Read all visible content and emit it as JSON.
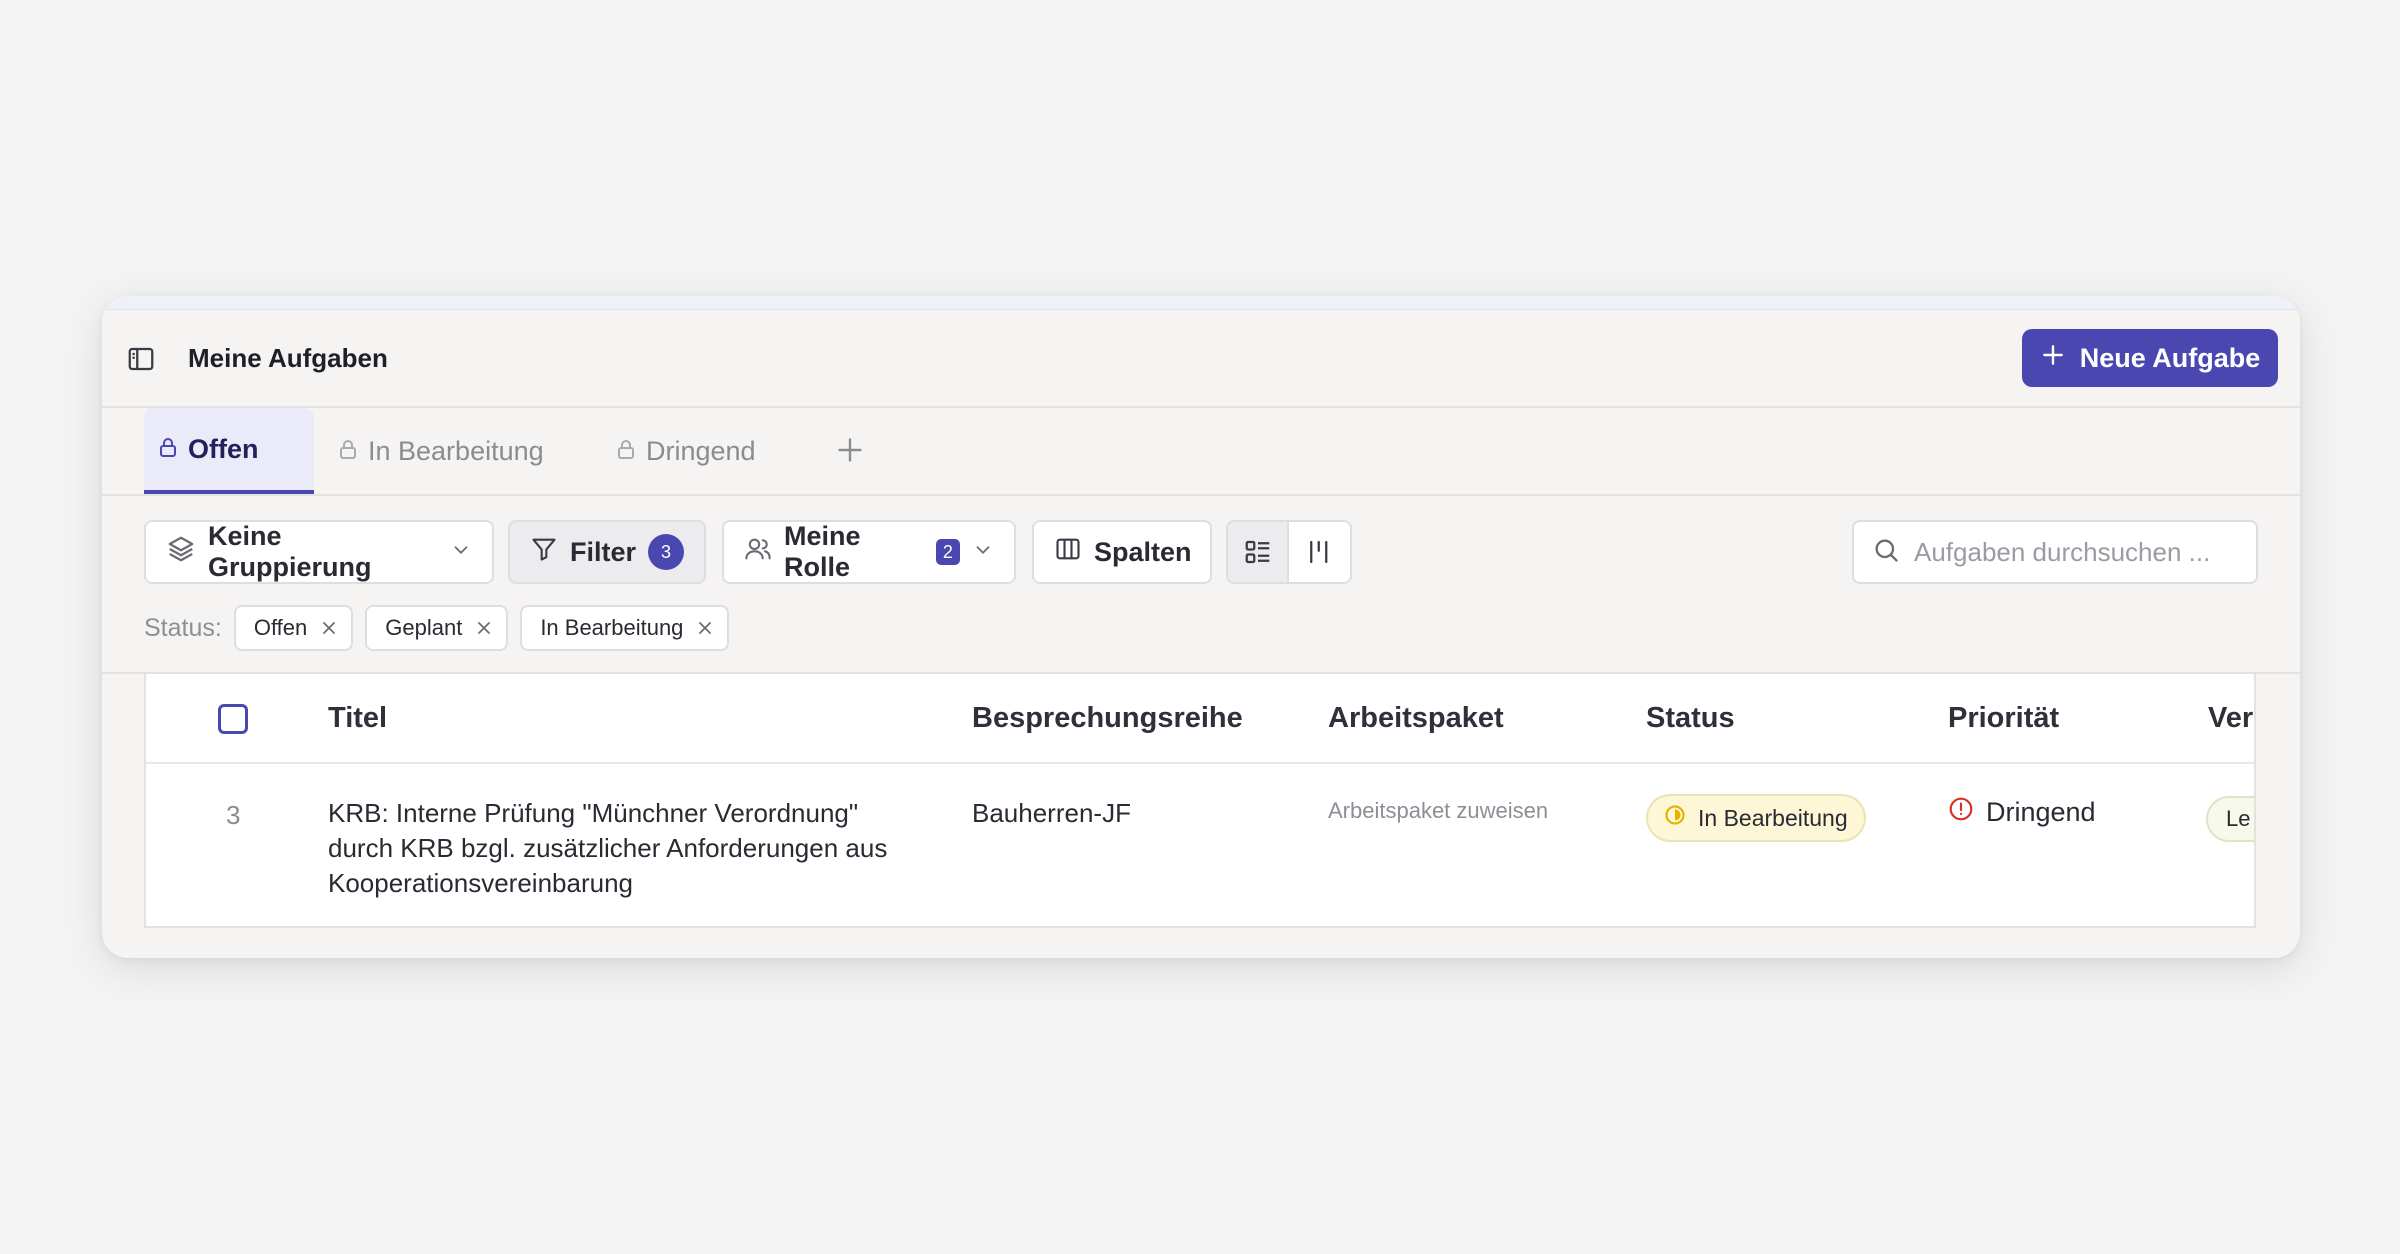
{
  "header": {
    "title": "Meine Aufgaben",
    "new_task_label": "Neue Aufgabe"
  },
  "tabs": [
    {
      "label": "Offen",
      "active": true
    },
    {
      "label": "In Bearbeitung",
      "active": false
    },
    {
      "label": "Dringend",
      "active": false
    }
  ],
  "toolbar": {
    "grouping_label": "Keine Gruppierung",
    "filter_label": "Filter",
    "filter_count": "3",
    "role_label": "Meine Rolle",
    "role_count": "2",
    "columns_label": "Spalten",
    "search_placeholder": "Aufgaben durchsuchen ..."
  },
  "status_filter": {
    "label": "Status:",
    "chips": [
      "Offen",
      "Geplant",
      "In Bearbeitung"
    ]
  },
  "table": {
    "columns": [
      "Titel",
      "Besprechungsreihe",
      "Arbeitspaket",
      "Status",
      "Priorität",
      "Ver"
    ],
    "rows": [
      {
        "number": "3",
        "title": "KRB: Interne Prüfung \"Münchner Verordnung\" durch KRB bzgl. zusätzlicher Anforderungen aus Kooperationsvereinbarung",
        "series": "Bauherren-JF",
        "work_package": "Arbeitspaket zuweisen",
        "status": "In Bearbeitung",
        "priority": "Dringend",
        "ver": "Le"
      }
    ]
  },
  "colors": {
    "accent": "#4a48b0",
    "status_in_progress_bg": "#fdf6d7",
    "status_in_progress_icon": "#e6b400",
    "priority_urgent": "#d93025"
  }
}
